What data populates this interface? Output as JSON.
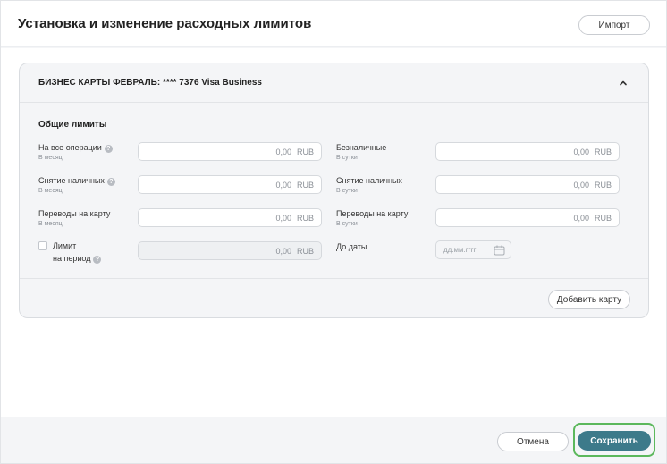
{
  "header": {
    "title": "Установка и изменение расходных лимитов",
    "import_label": "Импорт"
  },
  "card": {
    "title": "БИЗНЕС КАРТЫ ФЕВРАЛЬ: **** 7376 Visa Business",
    "section_title": "Общие лимиты",
    "fields": {
      "all_ops": {
        "label": "На все операции",
        "sub": "В месяц",
        "value": "0,00",
        "currency": "RUB"
      },
      "cash": {
        "label": "Снятие наличных",
        "sub": "В месяц",
        "value": "0,00",
        "currency": "RUB"
      },
      "card_transfers": {
        "label": "Переводы на карту",
        "sub": "В месяц",
        "value": "0,00",
        "currency": "RUB"
      },
      "period_limit": {
        "label1": "Лимит",
        "label2": "на период",
        "value": "0,00",
        "currency": "RUB"
      },
      "cashless": {
        "label": "Безналичные",
        "sub": "В сутки",
        "value": "0,00",
        "currency": "RUB"
      },
      "cash_daily": {
        "label": "Снятие наличных",
        "sub": "В сутки",
        "value": "0,00",
        "currency": "RUB"
      },
      "card_transfers_daily": {
        "label": "Переводы на карту",
        "sub": "В сутки",
        "value": "0,00",
        "currency": "RUB"
      },
      "until_date": {
        "label": "До даты",
        "placeholder": "дд.мм.гггг"
      }
    },
    "add_card_label": "Добавить карту"
  },
  "footer": {
    "cancel_label": "Отмена",
    "save_label": "Сохранить"
  },
  "colors": {
    "accent": "#3d7a8a",
    "focus_ring": "#5cb85c"
  },
  "icons": {
    "collapse": "chevron-up-icon",
    "help": "question-icon",
    "calendar": "calendar-icon"
  }
}
